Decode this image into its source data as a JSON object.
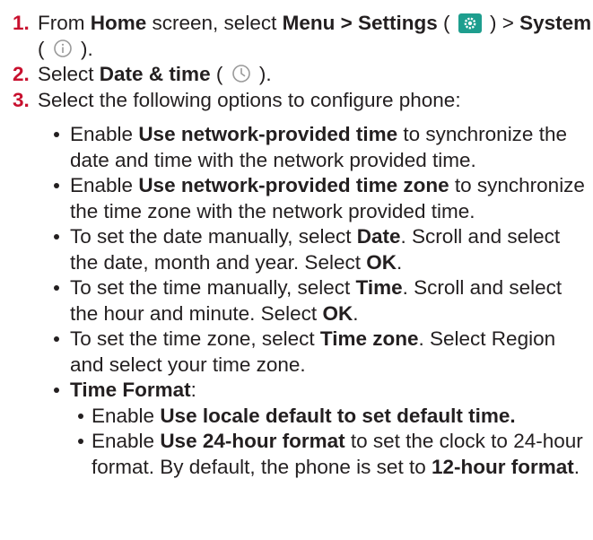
{
  "steps": [
    {
      "number": "1.",
      "t1": "From ",
      "b1": "Home",
      "t2": " screen, select ",
      "b2": "Menu > Settings",
      "t3": " ( ",
      "t4": " ) > ",
      "b3": "System",
      "t5": " ( ",
      "t6": " )."
    },
    {
      "number": "2.",
      "t1": "Select ",
      "b1": "Date & time",
      "t2": " ( ",
      "t3": " )."
    },
    {
      "number": "3.",
      "text": "Select the following options to configure phone:"
    }
  ],
  "options": [
    {
      "pre": "Enable ",
      "bold": "Use network-provided time",
      "post": " to synchronize the date and time with the network provided time."
    },
    {
      "pre": "Enable ",
      "bold": "Use network-provided time zone",
      "post": " to synchronize the time zone with the network provided time."
    },
    {
      "pre": "To set the date manually, select ",
      "bold": "Date",
      "post": ". Scroll and select the date, month and year. Select ",
      "bold2": "OK",
      "post2": "."
    },
    {
      "pre": "To set the time manually, select ",
      "bold": "Time",
      "post": ". Scroll and select the hour and minute. Select ",
      "bold2": "OK",
      "post2": "."
    },
    {
      "pre": "To set the time zone, select ",
      "bold": "Time zone",
      "post": ". Select Region and select your time zone."
    }
  ],
  "time_format": {
    "label": "Time Format",
    "colon": ":",
    "items": [
      {
        "pre": "Enable ",
        "bold": "Use locale default to set default time.",
        "post": ""
      },
      {
        "pre": "Enable ",
        "bold": "Use 24-hour format",
        "post": " to set the clock to 24-hour format. By default, the phone is set to ",
        "bold2": "12-hour format",
        "post2": "."
      }
    ]
  },
  "icons": {
    "settings": "gear-icon",
    "system": "info-icon",
    "date_time": "clock-icon",
    "settings_color": "#1e9e8e",
    "step_number_color": "#c8102e"
  }
}
